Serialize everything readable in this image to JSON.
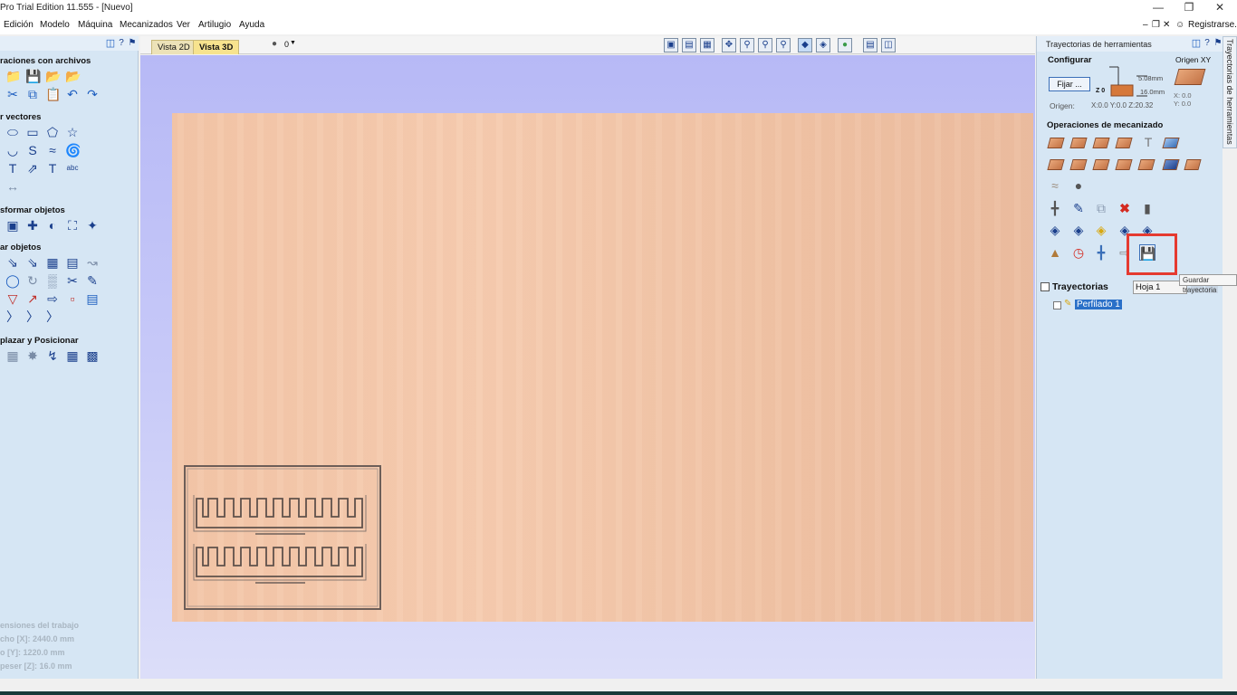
{
  "app": {
    "title": "Pro Trial Edition 11.555 - [Nuevo]"
  },
  "menubar": {
    "items": [
      "Edición",
      "Modelo",
      "Máquina",
      "Mecanizados",
      "Ver",
      "Artilugio",
      "Ayuda"
    ],
    "register": "Registrarse..."
  },
  "left_panel": {
    "sections": {
      "files": "raciones con archivos",
      "vectors": "r vectores",
      "transform": "sformar objetos",
      "edit": "ar objetos",
      "layout": "plazar y Posicionar"
    },
    "job_info": {
      "title": "ensiones del trabajo",
      "width": "cho  [X]: 2440.0 mm",
      "height": "o    [Y]: 1220.0 mm",
      "thickness": "peser [Z]: 16.0 mm"
    }
  },
  "view_tabs": {
    "tab_2d": "Vista 2D",
    "tab_3d": "Vista 3D",
    "layer": "0"
  },
  "right_panel": {
    "title": "Trayectorias de herramientas",
    "side_tab": "Trayectorias de herramientas",
    "configure": {
      "heading": "Configurar",
      "button": "Fijar ...",
      "z_label": "Z 0",
      "dim1": "5.08mm",
      "dim2": "16.0mm",
      "origin_label": "Origen:",
      "origin_value": "X:0.0 Y:0.0 Z:20.32",
      "origin_xy": "Origen XY",
      "x_val": "X: 0.0",
      "y_val": "Y: 0.0"
    },
    "operations_heading": "Operaciones de mecanizado",
    "toolpaths": {
      "heading": "Trayectorias",
      "sheet": "Hoja 1",
      "items": [
        "Perfilado 1"
      ]
    },
    "tooltip": "Guardar trayectoria"
  },
  "colors": {
    "highlight": "#e53a30",
    "panel_bg": "#d6e6f4",
    "viewport_top": "#b7b9f6"
  }
}
